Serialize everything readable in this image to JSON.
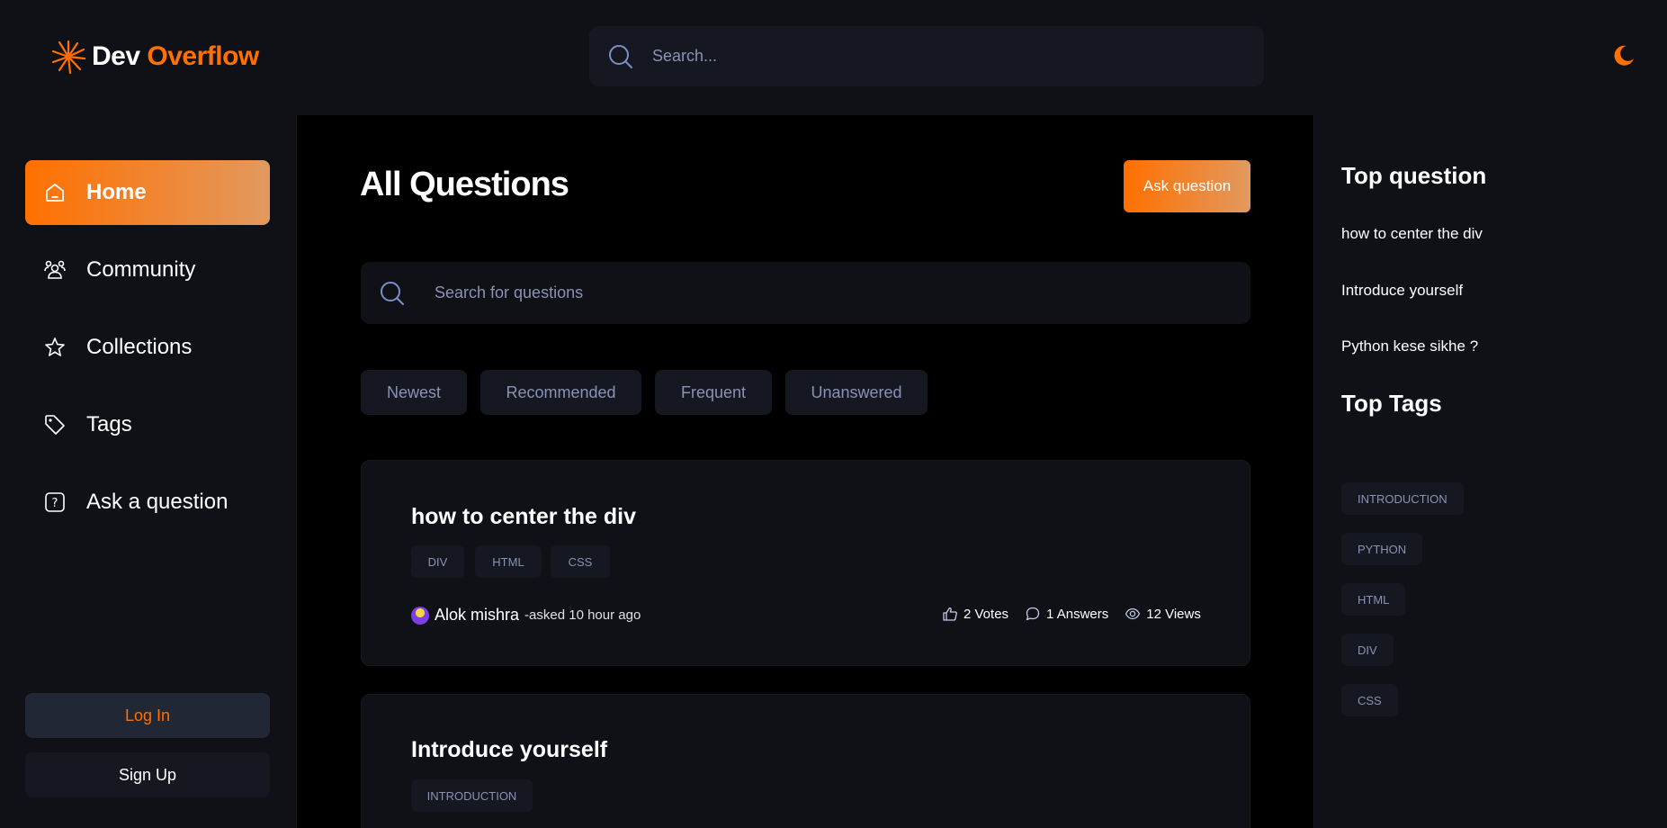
{
  "brand": {
    "name_part1": "Dev",
    "name_part2": "Overflow",
    "accent": "#ff7000"
  },
  "global_search": {
    "placeholder": "Search..."
  },
  "sidebar": {
    "items": [
      {
        "label": "Home",
        "icon": "home-icon",
        "active": true
      },
      {
        "label": "Community",
        "icon": "users-icon",
        "active": false
      },
      {
        "label": "Collections",
        "icon": "star-icon",
        "active": false
      },
      {
        "label": "Tags",
        "icon": "tag-icon",
        "active": false
      },
      {
        "label": "Ask a question",
        "icon": "question-icon",
        "active": false
      }
    ],
    "login_label": "Log In",
    "signup_label": "Sign Up"
  },
  "main": {
    "title": "All Questions",
    "ask_button": "Ask question",
    "search_placeholder": "Search for questions",
    "filters": [
      "Newest",
      "Recommended",
      "Frequent",
      "Unanswered"
    ],
    "questions": [
      {
        "title": "how to center the div",
        "tags": [
          "DIV",
          "HTML",
          "CSS"
        ],
        "author": "Alok mishra",
        "asked": "-asked 10 hour ago",
        "votes": "2 Votes",
        "answers": "1 Answers",
        "views": "12 Views"
      },
      {
        "title": "Introduce yourself",
        "tags": [
          "INTRODUCTION"
        ]
      }
    ]
  },
  "rightbar": {
    "top_question_heading": "Top question",
    "top_questions": [
      "how to center the div",
      "Introduce yourself",
      "Python kese sikhe ?"
    ],
    "top_tags_heading": "Top Tags",
    "top_tags": [
      "INTRODUCTION",
      "PYTHON",
      "HTML",
      "DIV",
      "CSS"
    ]
  }
}
